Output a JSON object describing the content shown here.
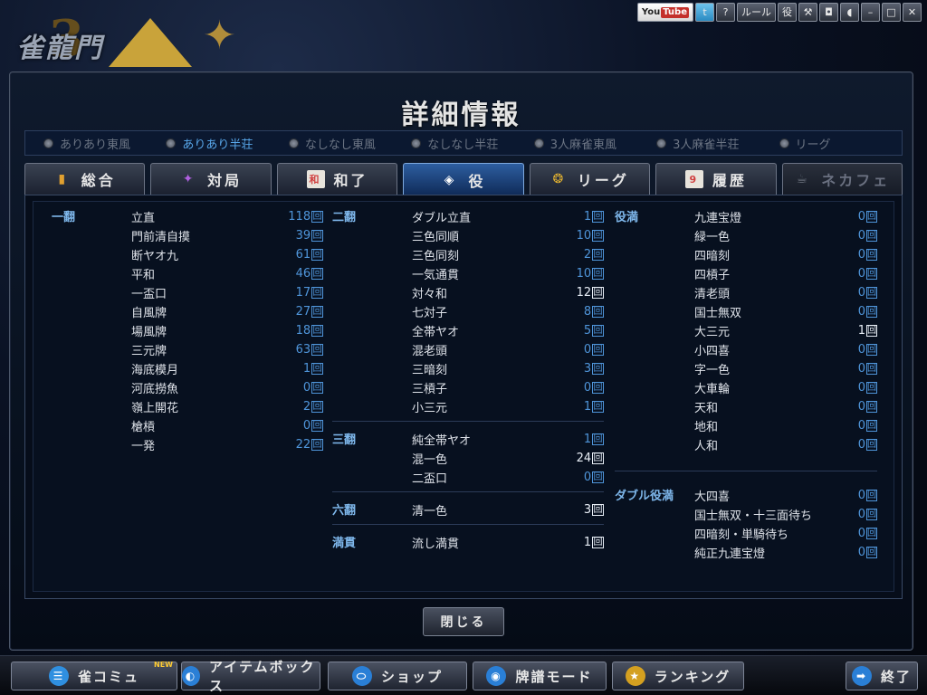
{
  "topbar": {
    "logo_text": "雀龍門",
    "buttons": [
      {
        "name": "youtube-button",
        "label": "You",
        "label2": "Tube"
      },
      {
        "name": "twitter-button",
        "label": "t"
      },
      {
        "name": "help-button",
        "label": "?"
      },
      {
        "name": "rules-button",
        "label": "ルール"
      },
      {
        "name": "yaku-button",
        "label": "役"
      },
      {
        "name": "hammer-button",
        "label": "⚒"
      },
      {
        "name": "camera-button",
        "label": "◘"
      },
      {
        "name": "sound-button",
        "label": "◖"
      },
      {
        "name": "minimize-button",
        "label": "–"
      },
      {
        "name": "maximize-button",
        "label": "□"
      },
      {
        "name": "close-window-button",
        "label": "✕"
      }
    ]
  },
  "title": "詳細情報",
  "modes": [
    {
      "label": "ありあり東風",
      "selected": false
    },
    {
      "label": "ありあり半荘",
      "selected": true
    },
    {
      "label": "なしなし東風",
      "selected": false
    },
    {
      "label": "なしなし半荘",
      "selected": false
    },
    {
      "label": "3人麻雀東風",
      "selected": false
    },
    {
      "label": "3人麻雀半荘",
      "selected": false
    },
    {
      "label": "リーグ",
      "selected": false
    }
  ],
  "tabs": [
    {
      "label": "総合",
      "icon": "bar-chart-icon",
      "glyph": "▮",
      "active": false,
      "disabled": false
    },
    {
      "label": "対局",
      "icon": "battle-icon",
      "glyph": "✦",
      "active": false,
      "disabled": false
    },
    {
      "label": "和了",
      "icon": "tile-icon",
      "glyph": "和",
      "active": false,
      "disabled": false
    },
    {
      "label": "役",
      "icon": "yaku-tile-icon",
      "glyph": "◈",
      "active": true,
      "disabled": false
    },
    {
      "label": "リーグ",
      "icon": "laurel-icon",
      "glyph": "❂",
      "active": false,
      "disabled": false
    },
    {
      "label": "履歴",
      "icon": "calendar-icon",
      "glyph": "9",
      "active": false,
      "disabled": false
    },
    {
      "label": "ネカフェ",
      "icon": "coffee-icon",
      "glyph": "☕",
      "active": false,
      "disabled": true
    }
  ],
  "unit": "回",
  "columns": [
    [
      {
        "group": "一翻",
        "rows": [
          {
            "name": "立直",
            "count": "118"
          },
          {
            "name": "門前清自摸",
            "count": "39"
          },
          {
            "name": "断ヤオ九",
            "count": "61"
          },
          {
            "name": "平和",
            "count": "46"
          },
          {
            "name": "一盃口",
            "count": "17"
          },
          {
            "name": "自風牌",
            "count": "27"
          },
          {
            "name": "場風牌",
            "count": "18"
          },
          {
            "name": "三元牌",
            "count": "63"
          },
          {
            "name": "海底模月",
            "count": "1"
          },
          {
            "name": "河底撈魚",
            "count": "0"
          },
          {
            "name": "嶺上開花",
            "count": "2"
          },
          {
            "name": "槍槓",
            "count": "0"
          },
          {
            "name": "一発",
            "count": "22"
          }
        ]
      }
    ],
    [
      {
        "group": "二翻",
        "rows": [
          {
            "name": "ダブル立直",
            "count": "1"
          },
          {
            "name": "三色同順",
            "count": "10"
          },
          {
            "name": "三色同刻",
            "count": "2"
          },
          {
            "name": "一気通貫",
            "count": "10"
          },
          {
            "name": "対々和",
            "count": "12",
            "hl": true
          },
          {
            "name": "七対子",
            "count": "8"
          },
          {
            "name": "全帯ヤオ",
            "count": "5"
          },
          {
            "name": "混老頭",
            "count": "0"
          },
          {
            "name": "三暗刻",
            "count": "3"
          },
          {
            "name": "三槓子",
            "count": "0"
          },
          {
            "name": "小三元",
            "count": "1"
          }
        ]
      },
      {
        "group": "三翻",
        "rows": [
          {
            "name": "純全帯ヤオ",
            "count": "1"
          },
          {
            "name": "混一色",
            "count": "24",
            "hl": true
          },
          {
            "name": "二盃口",
            "count": "0"
          }
        ]
      },
      {
        "group": "六翻",
        "rows": [
          {
            "name": "清一色",
            "count": "3",
            "hl": true
          }
        ]
      },
      {
        "group": "満貫",
        "rows": [
          {
            "name": "流し満貫",
            "count": "1",
            "hl": true
          }
        ]
      }
    ],
    [
      {
        "group": "役満",
        "rows": [
          {
            "name": "九連宝燈",
            "count": "0"
          },
          {
            "name": "緑一色",
            "count": "0"
          },
          {
            "name": "四暗刻",
            "count": "0"
          },
          {
            "name": "四槓子",
            "count": "0"
          },
          {
            "name": "清老頭",
            "count": "0"
          },
          {
            "name": "国士無双",
            "count": "0"
          },
          {
            "name": "大三元",
            "count": "1",
            "hl": true
          },
          {
            "name": "小四喜",
            "count": "0"
          },
          {
            "name": "字一色",
            "count": "0"
          },
          {
            "name": "大車輪",
            "count": "0"
          },
          {
            "name": "天和",
            "count": "0"
          },
          {
            "name": "地和",
            "count": "0"
          },
          {
            "name": "人和",
            "count": "0"
          }
        ]
      },
      {
        "group": "ダブル役満",
        "rows": [
          {
            "name": "大四喜",
            "count": "0"
          },
          {
            "name": "国士無双・十三面待ち",
            "count": "0"
          },
          {
            "name": "四暗刻・単騎待ち",
            "count": "0"
          },
          {
            "name": "純正九連宝燈",
            "count": "0"
          }
        ]
      }
    ]
  ],
  "close_label": "閉じる",
  "bottom": [
    {
      "label": "雀コミュ",
      "icon": "chat-icon",
      "glyph": "☰",
      "color": "#2f8fe0",
      "new": "NEW"
    },
    {
      "label": "アイテムボックス",
      "icon": "item-box-icon",
      "glyph": "◐",
      "color": "#2a7fd6"
    },
    {
      "label": "ショップ",
      "icon": "shop-icon",
      "glyph": "⬭",
      "color": "#2a7fd6"
    },
    {
      "label": "牌譜モード",
      "icon": "replay-icon",
      "glyph": "◉",
      "color": "#2a7fd6"
    },
    {
      "label": "ランキング",
      "icon": "star-icon",
      "glyph": "★",
      "color": "#d4a020"
    },
    {
      "label": "終了",
      "icon": "exit-arrow-icon",
      "glyph": "➡",
      "color": "#2a7fd6"
    }
  ]
}
